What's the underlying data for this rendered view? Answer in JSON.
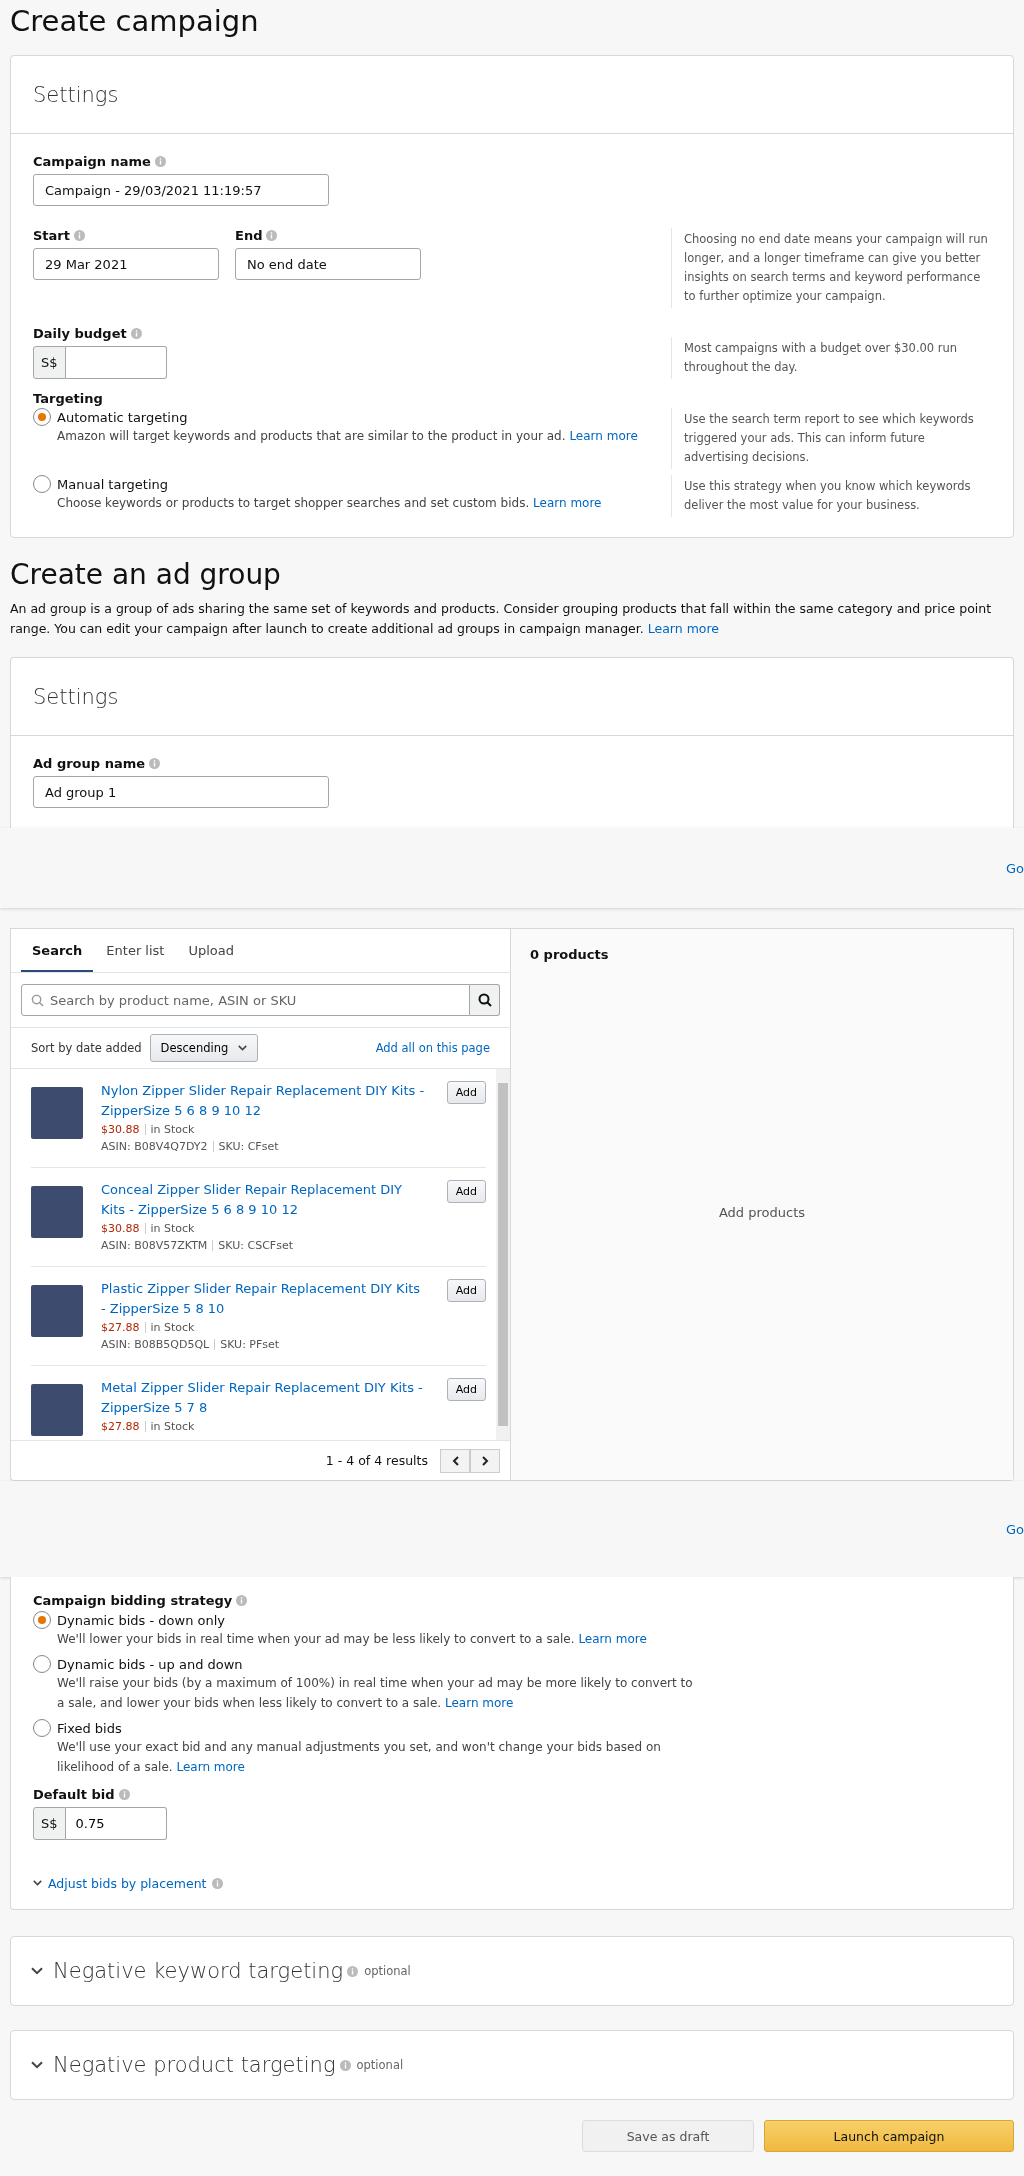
{
  "page_title": "Create campaign",
  "campaign_settings": {
    "title": "Settings",
    "campaign_name": {
      "label": "Campaign name",
      "value": "Campaign - 29/03/2021 11:19:57"
    },
    "start": {
      "label": "Start",
      "value": "29 Mar 2021"
    },
    "end": {
      "label": "End",
      "value": "No end date"
    },
    "dates_help": "Choosing no end date means your campaign will run longer, and a longer timeframe can give you better insights on search terms and keyword performance to further optimize your campaign.",
    "daily_budget": {
      "label": "Daily budget",
      "currency": "S$"
    },
    "budget_help": "Most campaigns with a budget over $30.00 run throughout the day.",
    "targeting": {
      "label": "Targeting",
      "options": [
        {
          "label": "Automatic targeting",
          "description": "Amazon will target keywords and products that are similar to the product in your ad.",
          "link": "Learn more",
          "help": "Use the search term report to see which keywords triggered your ads. This can inform future advertising decisions.",
          "selected": true
        },
        {
          "label": "Manual targeting",
          "description": "Choose keywords or products to target shopper searches and set custom bids.",
          "link": "Learn more",
          "help": "Use this strategy when you know which keywords deliver the most value for your business.",
          "selected": false
        }
      ]
    }
  },
  "ad_group": {
    "title": "Create an ad group",
    "description": "An ad group is a group of ads sharing the same set of keywords and products. Consider grouping products that fall within the same category and price point range. You can edit your campaign after launch to create additional ad groups in campaign manager.",
    "link": "Learn more",
    "settings_title": "Settings",
    "name": {
      "label": "Ad group name",
      "value": "Ad group 1"
    }
  },
  "bands": [
    {
      "link": "Go"
    },
    {
      "link": "Go"
    }
  ],
  "products": {
    "tabs": [
      {
        "label": "Search",
        "selected": true
      },
      {
        "label": "Enter list",
        "selected": false
      },
      {
        "label": "Upload",
        "selected": false
      }
    ],
    "search": {
      "placeholder": "Search by product name, ASIN or SKU"
    },
    "sort": {
      "label": "Sort by date added",
      "value": "Descending"
    },
    "add_all": "Add all on this page",
    "items": [
      {
        "title": "Nylon Zipper Slider Repair Replacement DIY Kits - ZipperSize 5 6 8 9 10 12",
        "price": "$30.88",
        "stock": "in Stock",
        "asin": "ASIN: B08V4Q7DY2",
        "sku": "SKU: CFset",
        "button": "Add"
      },
      {
        "title": "Conceal Zipper Slider Repair Replacement DIY Kits - ZipperSize 5 6 8 9 10 12",
        "price": "$30.88",
        "stock": "in Stock",
        "asin": "ASIN: B08V57ZKTM",
        "sku": "SKU: CSCFset",
        "button": "Add"
      },
      {
        "title": "Plastic Zipper Slider Repair Replacement DIY Kits - ZipperSize 5 8 10",
        "price": "$27.88",
        "stock": "in Stock",
        "asin": "ASIN: B08B5QD5QL",
        "sku": "SKU: PFset",
        "button": "Add"
      },
      {
        "title": "Metal Zipper Slider Repair Replacement DIY Kits - ZipperSize 5 7 8",
        "price": "$27.88",
        "stock": "in Stock",
        "button": "Add"
      }
    ],
    "pagination": "1 - 4 of 4 results",
    "selected_count": "0 products",
    "empty": "Add products"
  },
  "bidding": {
    "label": "Campaign bidding strategy",
    "options": [
      {
        "label": "Dynamic bids - down only",
        "description": "We'll lower your bids in real time when your ad may be less likely to convert to a sale.",
        "link": "Learn more",
        "selected": true
      },
      {
        "label": "Dynamic bids - up and down",
        "description": "We'll raise your bids (by a maximum of 100%) in real time when your ad may be more likely to convert to a sale, and lower your bids when less likely to convert to a sale.",
        "link": "Learn more",
        "selected": false
      },
      {
        "label": "Fixed bids",
        "description": "We'll use your exact bid and any manual adjustments you set, and won't change your bids based on likelihood of a sale.",
        "link": "Learn more",
        "selected": false
      }
    ],
    "default_bid": {
      "label": "Default bid",
      "currency": "S$",
      "value": "0.75"
    },
    "adjust_link": "Adjust bids by placement"
  },
  "collapsed_sections": [
    {
      "title": "Negative keyword targeting",
      "note": "optional"
    },
    {
      "title": "Negative product targeting",
      "note": "optional"
    }
  ],
  "actions": [
    {
      "label": "Save as draft",
      "kind": "secondary"
    },
    {
      "label": "Launch campaign",
      "kind": "primary"
    }
  ]
}
